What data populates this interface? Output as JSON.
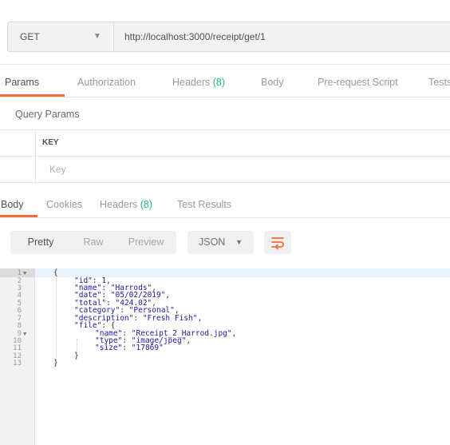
{
  "request": {
    "method": "GET",
    "url": "http://localhost:3000/receipt/get/1"
  },
  "request_tabs": {
    "params": "Params",
    "authorization": "Authorization",
    "headers_label": "Headers",
    "headers_count": "(8)",
    "body": "Body",
    "pre_request": "Pre-request Script",
    "tests": "Tests"
  },
  "query_params": {
    "title": "Query Params",
    "key_header": "KEY",
    "key_placeholder": "Key"
  },
  "response_tabs": {
    "body": "Body",
    "cookies": "Cookies",
    "headers_label": "Headers",
    "headers_count": "(8)",
    "test_results": "Test Results"
  },
  "toolbar": {
    "pretty": "Pretty",
    "raw": "Raw",
    "preview": "Preview",
    "format": "JSON",
    "wrap_icon": "wrap-lines-icon"
  },
  "code": {
    "line_numbers": [
      "1",
      "2",
      "3",
      "4",
      "5",
      "6",
      "7",
      "8",
      "9",
      "10",
      "11",
      "12",
      "13"
    ],
    "lines": {
      "l1": "{",
      "id_key": "\"id\"",
      "id_val": "1",
      "name_key": "\"name\"",
      "name_val": "\"Harrods\"",
      "date_key": "\"date\"",
      "date_val": "\"05/02/2019\"",
      "total_key": "\"total\"",
      "total_val": "\"424.02\"",
      "category_key": "\"category\"",
      "category_val": "\"Personal\"",
      "description_key": "\"description\"",
      "description_val": "\"Fresh Fish\"",
      "file_key": "\"file\"",
      "fname_key": "\"name\"",
      "fname_val": "\"Receipt_2_Harrod.jpg\"",
      "type_key": "\"type\"",
      "type_val": "\"image/jpeg\"",
      "size_key": "\"size\"",
      "size_val": "\"17869\"",
      "close_file": "}",
      "close_root": "}"
    }
  },
  "colors": {
    "accent": "#f26b3a",
    "count_green": "#26b47f"
  }
}
